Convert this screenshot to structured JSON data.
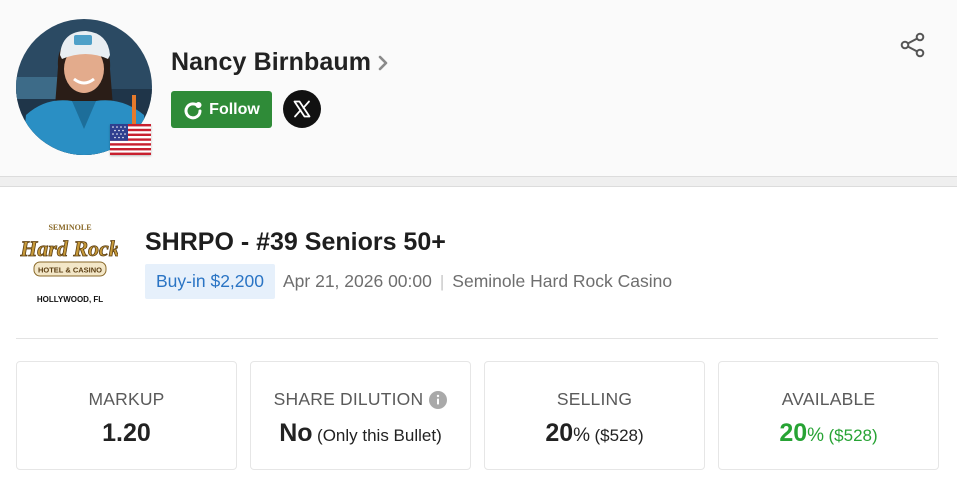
{
  "player": {
    "name": "Nancy Birnbaum",
    "follow_label": "Follow",
    "icons": {
      "chevron": "chevron-right-icon",
      "follow": "follow-icon",
      "social": "x-twitter-icon",
      "share": "share-icon",
      "flag": "us-flag-icon"
    }
  },
  "event": {
    "venue_logo": {
      "top_text": "SEMINOLE",
      "brand": "Hard Rock",
      "sub": "HOTEL & CASINO",
      "location": "HOLLYWOOD, FL"
    },
    "title": "SHRPO - #39 Seniors 50+",
    "buyin": "Buy-in $2,200",
    "date": "Apr 21, 2026 00:00",
    "separator": "|",
    "venue": "Seminole Hard Rock Casino"
  },
  "stats": {
    "markup": {
      "label": "MARKUP",
      "value": "1.20"
    },
    "share_dilution": {
      "label": "SHARE DILUTION",
      "value": "No",
      "note": "(Only this Bullet)",
      "icon": "info-icon"
    },
    "selling": {
      "label": "SELLING",
      "value": "20",
      "unit": "%",
      "amount": "($528)"
    },
    "available": {
      "label": "AVAILABLE",
      "value": "20",
      "unit": "%",
      "amount": "($528)"
    }
  },
  "colors": {
    "follow_button": "#2f8b38",
    "buyin_bg": "#e6f0fb",
    "buyin_text": "#2a74c4",
    "available_green": "#27a334"
  }
}
